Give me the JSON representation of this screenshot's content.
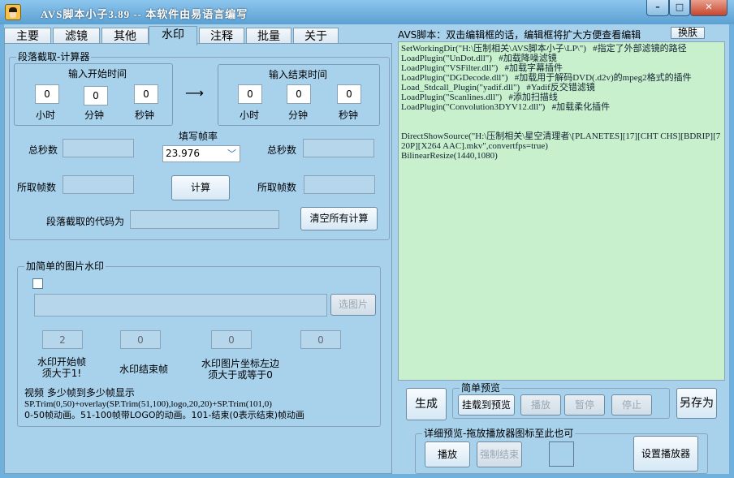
{
  "window": {
    "title": "AVS脚本小子3.89  -- 本软件由易语言编写",
    "min_glyph": "–",
    "max_glyph": "□",
    "close_glyph": "✕"
  },
  "tabs": [
    "主要",
    "滤镜",
    "其他",
    "水印",
    "注释",
    "批量",
    "关于"
  ],
  "active_tab": "水印",
  "segment_calc": {
    "group_label": "段落截取-计算器",
    "start_box": {
      "title": "输入开始时间",
      "hours": "0",
      "minutes": "0",
      "seconds": "0"
    },
    "end_box": {
      "title": "输入结束时间",
      "hours": "0",
      "minutes": "0",
      "seconds": "0"
    },
    "unit_labels": [
      "小时",
      "分钟",
      "秒钟"
    ],
    "arrow": "⟶",
    "total_seconds_label": "总秒数",
    "frame_rate_label": "填写帧率",
    "frame_rate_value": "23.976",
    "frame_count_label": "所取帧数",
    "calc_button": "计算",
    "code_label": "段落截取的代码为",
    "clear_button": "清空所有计算"
  },
  "watermark": {
    "group_label": "加简单的图片水印",
    "choose_button": "选图片",
    "fields": [
      "2",
      "0",
      "0",
      "0"
    ],
    "start_frame_label": "水印开始帧\n须大于1!",
    "end_frame_label": "水印结束帧",
    "coord_label": "水印图片坐标左边\n须大于或等于0",
    "note_line1": "视频  多少帧到多少帧显示",
    "note_line2": "SP.Trim(0,50)+overlay(SP.Trim(51,100),logo,20,20)+SP.Trim(101,0)",
    "note_line3": "0-50帧动画。51-100帧带LOGO的动画。101-结束(0表示结束)帧动画"
  },
  "script_panel": {
    "header": "AVS脚本：双击编辑框的话，编辑框将扩大方便查看编辑",
    "skin_button": "换肤",
    "lines": [
      "SetWorkingDir(\"H:\\压制相关\\AVS脚本小子\\LP\\\")   #指定了外部滤镜的路径",
      "LoadPlugin(\"UnDot.dll\")   #加载降噪滤镜",
      "LoadPlugin(\"VSFilter.dll\")   #加载字幕插件",
      "LoadPlugin(\"DGDecode.dll\")   #加载用于解码DVD(.d2v)的mpeg2格式的插件",
      "Load_Stdcall_Plugin(\"yadif.dll\")   #Yadif反交错滤镜",
      "LoadPlugin(\"Scanlines.dll\")   #添加扫描线",
      "LoadPlugin(\"Convolution3DYV12.dll\")   #加载柔化插件",
      "",
      "",
      "DirectShowSource(\"H:\\压制相关\\星空清理者\\[PLANETES][17][CHT CHS][BDRIP][720P][X264 AAC].mkv\",convertfps=true)",
      "BilinearResize(1440,1080)"
    ]
  },
  "bottom": {
    "generate_button": "生成",
    "simple_preview_label": "简单预览",
    "mount_preview_button": "挂载到预览",
    "play_button": "播放",
    "pause_button": "暂停",
    "stop_button": "停止",
    "save_as_button": "另存为",
    "detail_preview_label": "详细预览-拖放播放器图标至此也可",
    "detail_play_button": "播放",
    "force_end_button": "强制结束",
    "set_player_button": "设置播放器"
  }
}
